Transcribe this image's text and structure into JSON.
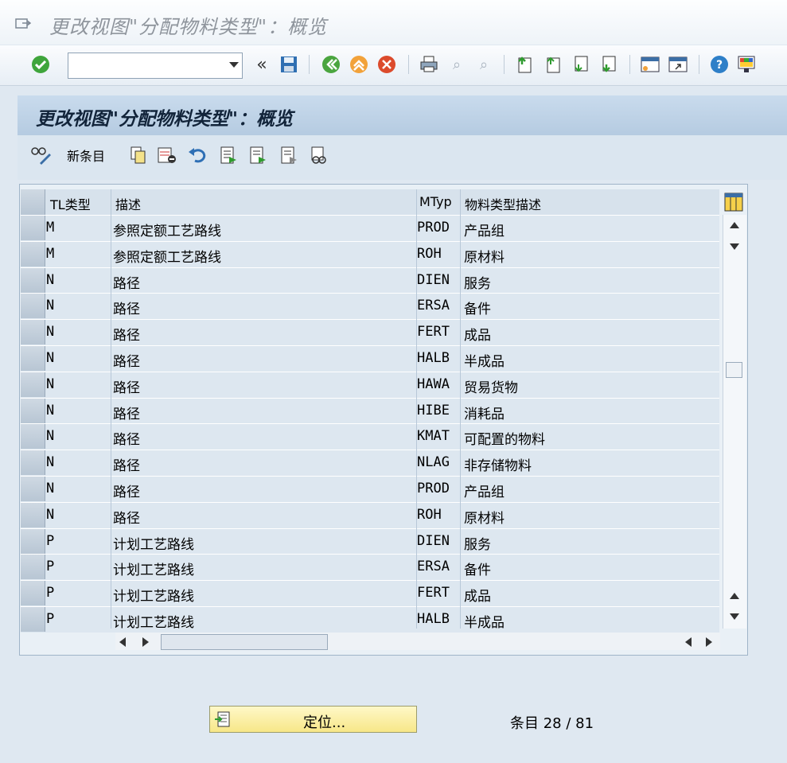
{
  "window": {
    "title": "更改视图\"分配物料类型\"：概览"
  },
  "screen": {
    "title": "更改视图\"分配物料类型\"：概览"
  },
  "command_field": {
    "value": ""
  },
  "app_toolbar": {
    "new_entries_label": "新条目"
  },
  "table": {
    "columns": {
      "tl_type": "TL类型",
      "description": "描述",
      "mtyp": "MTyp",
      "mtyp_desc": "物料类型描述"
    },
    "rows": [
      {
        "tl": "M",
        "desc": "参照定额工艺路线",
        "mtyp": "PROD",
        "mdesc": "产品组"
      },
      {
        "tl": "M",
        "desc": "参照定额工艺路线",
        "mtyp": "ROH",
        "mdesc": "原材料"
      },
      {
        "tl": "N",
        "desc": "路径",
        "mtyp": "DIEN",
        "mdesc": "服务"
      },
      {
        "tl": "N",
        "desc": "路径",
        "mtyp": "ERSA",
        "mdesc": "备件"
      },
      {
        "tl": "N",
        "desc": "路径",
        "mtyp": "FERT",
        "mdesc": "成品"
      },
      {
        "tl": "N",
        "desc": "路径",
        "mtyp": "HALB",
        "mdesc": "半成品"
      },
      {
        "tl": "N",
        "desc": "路径",
        "mtyp": "HAWA",
        "mdesc": "贸易货物"
      },
      {
        "tl": "N",
        "desc": "路径",
        "mtyp": "HIBE",
        "mdesc": "消耗品"
      },
      {
        "tl": "N",
        "desc": "路径",
        "mtyp": "KMAT",
        "mdesc": "可配置的物料"
      },
      {
        "tl": "N",
        "desc": "路径",
        "mtyp": "NLAG",
        "mdesc": "非存储物料"
      },
      {
        "tl": "N",
        "desc": "路径",
        "mtyp": "PROD",
        "mdesc": "产品组"
      },
      {
        "tl": "N",
        "desc": "路径",
        "mtyp": "ROH",
        "mdesc": "原材料"
      },
      {
        "tl": "P",
        "desc": "计划工艺路线",
        "mtyp": "DIEN",
        "mdesc": "服务"
      },
      {
        "tl": "P",
        "desc": "计划工艺路线",
        "mtyp": "ERSA",
        "mdesc": "备件"
      },
      {
        "tl": "P",
        "desc": "计划工艺路线",
        "mtyp": "FERT",
        "mdesc": "成品"
      },
      {
        "tl": "P",
        "desc": "计划工艺路线",
        "mtyp": "HALB",
        "mdesc": "半成品"
      }
    ]
  },
  "footer": {
    "position_button": "定位...",
    "entry_info": "条目 28 / 81"
  },
  "icons": {
    "toolbar": [
      "enter-icon",
      "back-icon",
      "save-icon",
      "green-back-icon",
      "exit-icon",
      "cancel-icon",
      "print-icon",
      "find-icon",
      "find-next-icon",
      "first-page-icon",
      "previous-page-icon",
      "next-page-icon",
      "last-page-icon",
      "create-session-icon",
      "shortcut-icon",
      "help-icon",
      "layout-icon"
    ]
  }
}
